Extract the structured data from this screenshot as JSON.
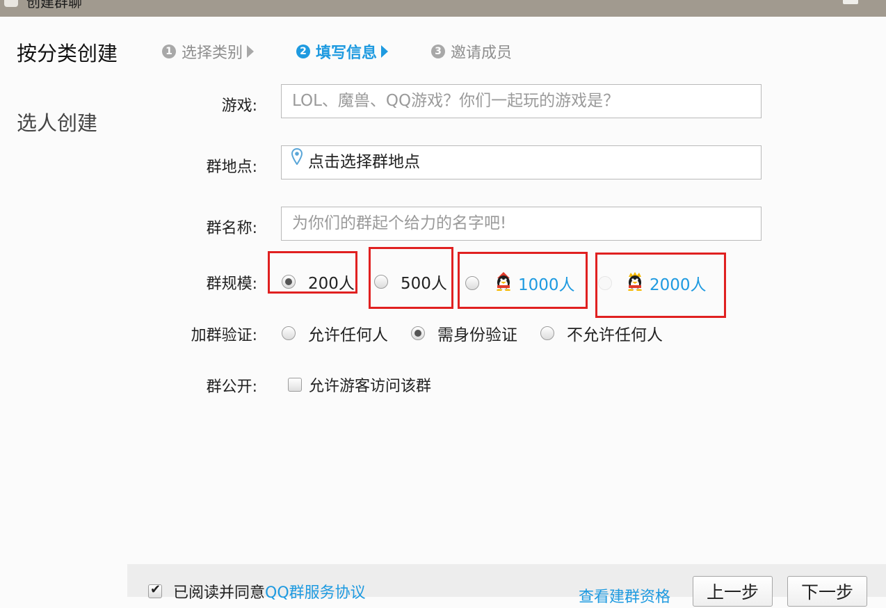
{
  "window": {
    "title": "创建群聊"
  },
  "nav": {
    "category_create": "按分类创建",
    "select_create": "选人创建"
  },
  "steps": [
    {
      "num": "1",
      "label": "选择类别"
    },
    {
      "num": "2",
      "label": "填写信息"
    },
    {
      "num": "3",
      "label": "邀请成员"
    }
  ],
  "form": {
    "game": {
      "label": "游戏:",
      "placeholder": "LOL、魔兽、QQ游戏？你们一起玩的游戏是？",
      "value": ""
    },
    "location": {
      "label": "群地点:",
      "value": "点击选择群地点",
      "icon": "location-pin-icon"
    },
    "name": {
      "label": "群名称:",
      "placeholder": "为你们的群起个给力的名字吧!",
      "value": ""
    },
    "scale": {
      "label": "群规模:",
      "options": [
        "200人",
        "500人",
        "1000人",
        "2000人"
      ],
      "selected": "200人",
      "badge_icons": [
        "qq-vip-penguin-icon",
        "qq-svip-penguin-icon"
      ]
    },
    "verify": {
      "label": "加群验证:",
      "options": [
        "允许任何人",
        "需身份验证",
        "不允许任何人"
      ],
      "selected": "需身份验证"
    },
    "public": {
      "label": "群公开:",
      "checkbox_label": "允许游客访问该群",
      "checked": false
    }
  },
  "footer": {
    "agree_text": "已阅读并同意",
    "agree_link": "QQ群服务协议",
    "agree_checked": true,
    "qualify_link": "查看建群资格",
    "prev_label": "上一步",
    "next_label": "下一步"
  },
  "colors": {
    "accent": "#1e9ae0",
    "highlight": "#e02020",
    "titlebar": "#a19a8f"
  }
}
